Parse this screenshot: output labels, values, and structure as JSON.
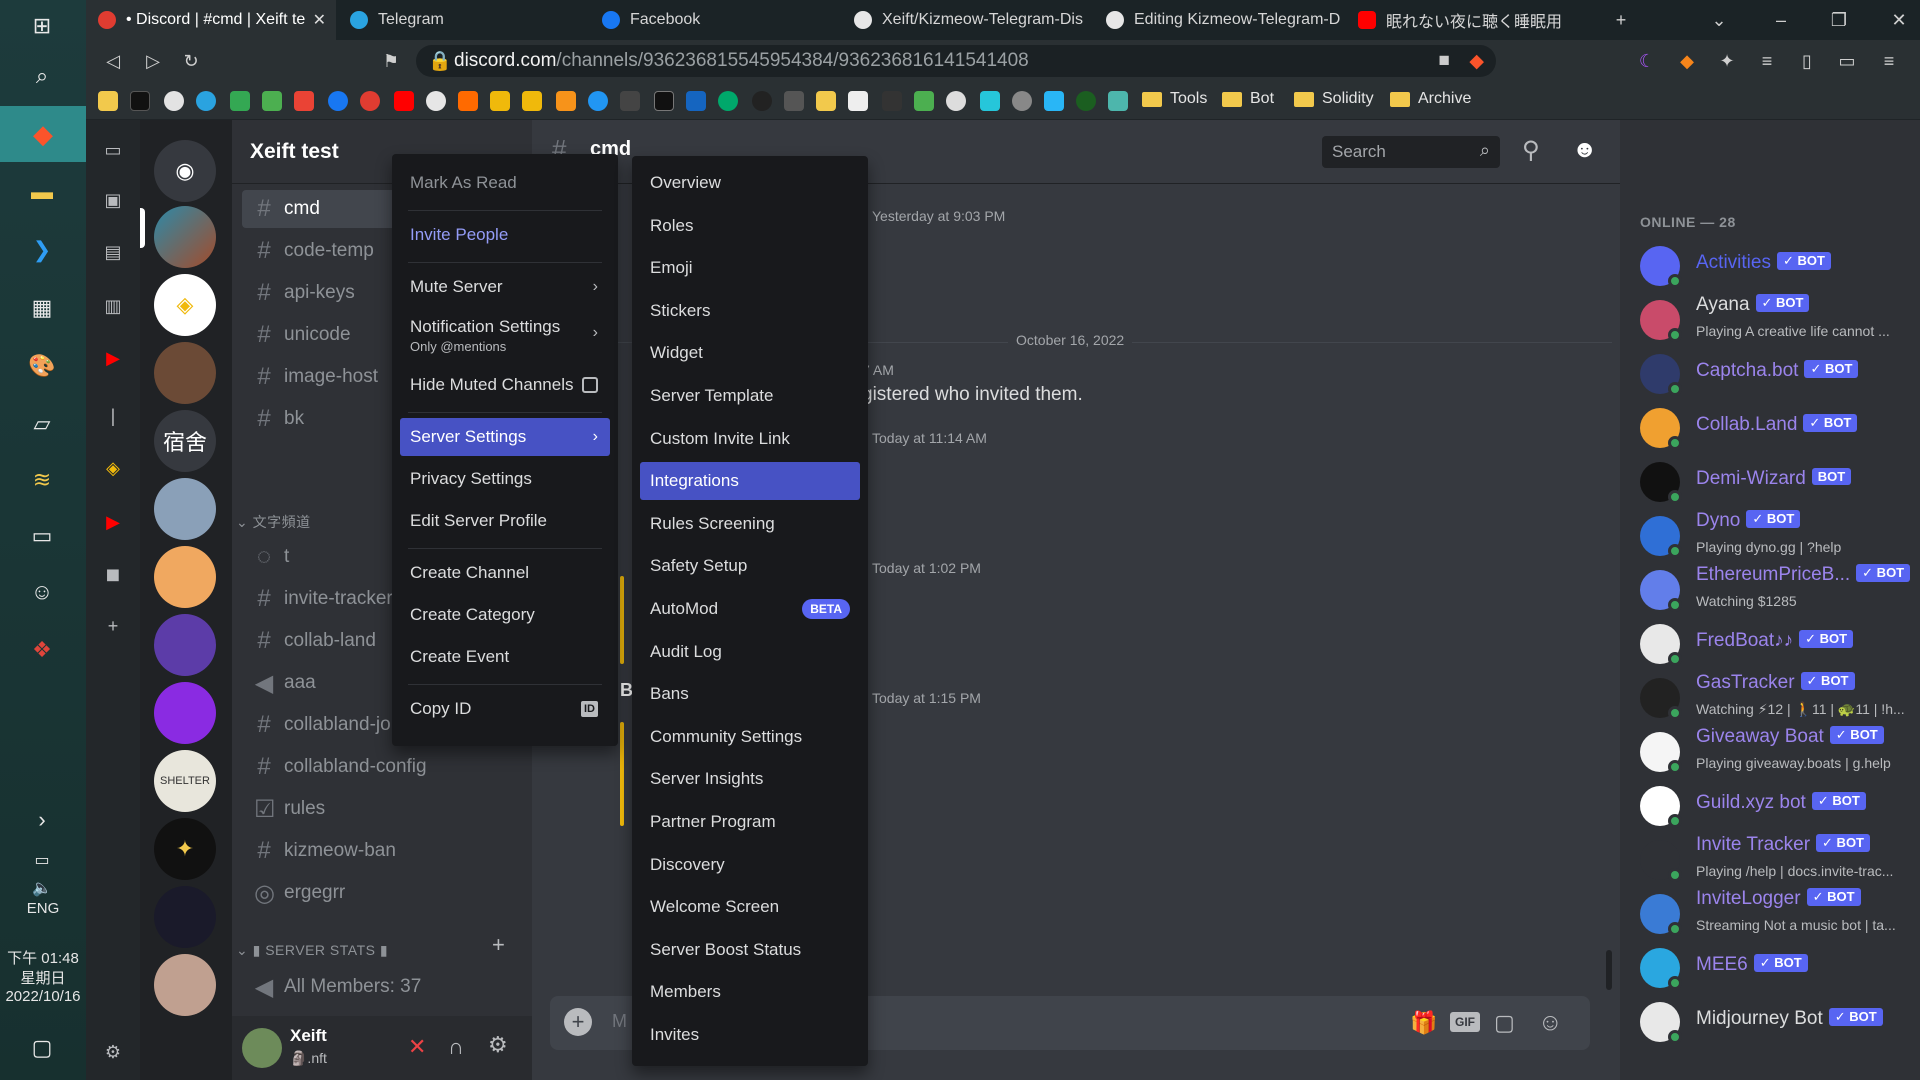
{
  "taskbar": {
    "lang": "ENG",
    "time": "下午 01:48",
    "weekday": "星期日",
    "date": "2022/10/16"
  },
  "browser": {
    "tabs": [
      {
        "label": "• Discord | #cmd | Xeift te",
        "color": "#e03c31"
      },
      {
        "label": "Telegram",
        "color": "#2aa3e0"
      },
      {
        "label": "Facebook",
        "color": "#1877f2"
      },
      {
        "label": "Xeift/Kizmeow-Telegram-Dis",
        "color": "#e6e6e6"
      },
      {
        "label": "Editing Kizmeow-Telegram-D",
        "color": "#e6e6e6"
      },
      {
        "label": "眠れない夜に聴く睡眠用",
        "color": "#ff0000"
      }
    ],
    "url_domain": "discord.com",
    "url_path": "/channels/936236815545954384/936236816141541408",
    "bookmark_folders": [
      "Tools",
      "Bot",
      "Solidity",
      "Archive"
    ]
  },
  "server": {
    "name": "Xeift test",
    "channels": [
      {
        "name": "cmd",
        "icon": "#",
        "selected": true
      },
      {
        "name": "code-temp",
        "icon": "#"
      },
      {
        "name": "api-keys",
        "icon": "#"
      },
      {
        "name": "unicode",
        "icon": "#"
      },
      {
        "name": "image-host",
        "icon": "#"
      },
      {
        "name": "bk",
        "icon": "#"
      }
    ],
    "category1": "文字頻道",
    "channels2": [
      {
        "name": "t",
        "icon": "◌"
      },
      {
        "name": "invite-tracker",
        "icon": "#"
      },
      {
        "name": "collab-land",
        "icon": "#"
      },
      {
        "name": "aaa",
        "icon": "◀"
      },
      {
        "name": "collabland-jo",
        "icon": "#"
      },
      {
        "name": "collabland-config",
        "icon": "#"
      },
      {
        "name": "rules",
        "icon": "☑"
      },
      {
        "name": "kizmeow-ban",
        "icon": "#"
      },
      {
        "name": "ergegrr",
        "icon": "◎"
      }
    ],
    "category2": "SERVER STATS",
    "stats_channel": "All Members: 37",
    "user": {
      "name": "Xeift",
      "status": "🗿.nft"
    }
  },
  "chat": {
    "channel": "cmd",
    "search_placeholder": "Search",
    "timestamps": [
      "Yesterday at 9:03 PM",
      "Today at 11:14 AM",
      "Today at 1:02 PM",
      "Today at 1:15 PM"
    ],
    "date_divider": "October 16, 2022",
    "partial_time": "7 AM",
    "partial_text": "gistered who invited them.",
    "partial_author": "Bi",
    "composer_placeholder": "M"
  },
  "members": {
    "header": "ONLINE — 28",
    "bot_label": "✓ BOT",
    "list": [
      {
        "name": "Activities",
        "status": "",
        "color": "#5865f2"
      },
      {
        "name": "Ayana",
        "status": "Playing A creative life cannot ...",
        "color": "#dcddde"
      },
      {
        "name": "Captcha.bot",
        "status": "",
        "color": "#9b84ec"
      },
      {
        "name": "Collab.Land",
        "status": "",
        "color": "#9b84ec"
      },
      {
        "name": "Demi-Wizard",
        "status": "",
        "color": "#9b84ec",
        "nocheck": true
      },
      {
        "name": "Dyno",
        "status": "Playing dyno.gg | ?help",
        "color": "#9b84ec"
      },
      {
        "name": "EthereumPriceB...",
        "status": "Watching $1285",
        "color": "#9b84ec"
      },
      {
        "name": "FredBoat♪♪",
        "status": "",
        "color": "#9b84ec"
      },
      {
        "name": "GasTracker",
        "status": "Watching ⚡12 | 🚶11 | 🐢11 | !h...",
        "color": "#9b84ec"
      },
      {
        "name": "Giveaway Boat",
        "status": "Playing giveaway.boats | g.help",
        "color": "#9b84ec"
      },
      {
        "name": "Guild.xyz bot",
        "status": "",
        "color": "#9b84ec"
      },
      {
        "name": "Invite Tracker",
        "status": "Playing /help | docs.invite-trac...",
        "color": "#9b84ec"
      },
      {
        "name": "InviteLogger",
        "status": "Streaming Not a music bot | ta...",
        "color": "#9b84ec"
      },
      {
        "name": "MEE6",
        "status": "",
        "color": "#9b84ec"
      },
      {
        "name": "Midjourney Bot",
        "status": "",
        "color": "#dcddde"
      }
    ]
  },
  "context_menu": {
    "items": [
      "Mark As Read",
      "Invite People",
      "Mute Server",
      "Notification Settings",
      "Hide Muted Channels",
      "Server Settings",
      "Privacy Settings",
      "Edit Server Profile",
      "Create Channel",
      "Create Category",
      "Create Event",
      "Copy ID"
    ],
    "notif_sub": "Only @mentions",
    "copy_id_badge": "ID"
  },
  "settings_submenu": {
    "items": [
      "Overview",
      "Roles",
      "Emoji",
      "Stickers",
      "Widget",
      "Server Template",
      "Custom Invite Link",
      "Integrations",
      "Rules Screening",
      "Safety Setup",
      "AutoMod",
      "Audit Log",
      "Bans",
      "Community Settings",
      "Server Insights",
      "Partner Program",
      "Discovery",
      "Welcome Screen",
      "Server Boost Status",
      "Members",
      "Invites"
    ],
    "highlighted": "Integrations",
    "beta_label": "BETA"
  }
}
